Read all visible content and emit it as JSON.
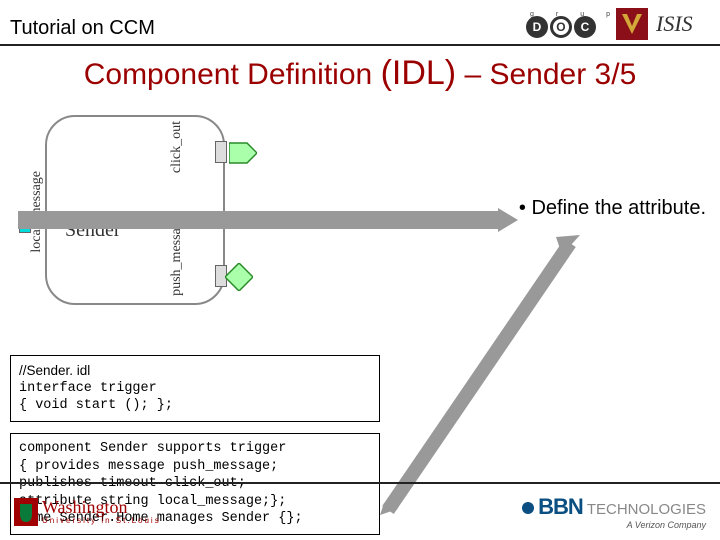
{
  "header": {
    "title": "Tutorial on CCM",
    "doc_sup": {
      "g": "g",
      "r": "r",
      "u": "u",
      "p": "p"
    },
    "doc": {
      "d": "D",
      "o": "O",
      "c": "C"
    }
  },
  "slide": {
    "title_pre": "Component Definition ",
    "title_idl": "(IDL)",
    "title_post": " – Sender 3/5",
    "diagram": {
      "sender": "Sender",
      "local_message": "local_message",
      "click_out": "click_out",
      "push_message": "push_message"
    },
    "bullet": "• Define the attribute.",
    "code1": {
      "l1": "//Sender. idl",
      "l2": "interface trigger",
      "l3": "{ void start (); };"
    },
    "code2": {
      "l1": "component Sender supports trigger",
      "l2": "{ provides message push_message;",
      "l3": "  publishes timeout click_out;",
      "l4": "  attribute string local_message;};",
      "l5": "home Sender.Home manages Sender {};"
    }
  },
  "footer": {
    "wustl_main": "Washington",
    "wustl_sub": "University in St.Louis",
    "bbn_main": "BBN",
    "bbn_tech": "TECHNOLOGIES",
    "bbn_sub": "A Verizon Company"
  }
}
